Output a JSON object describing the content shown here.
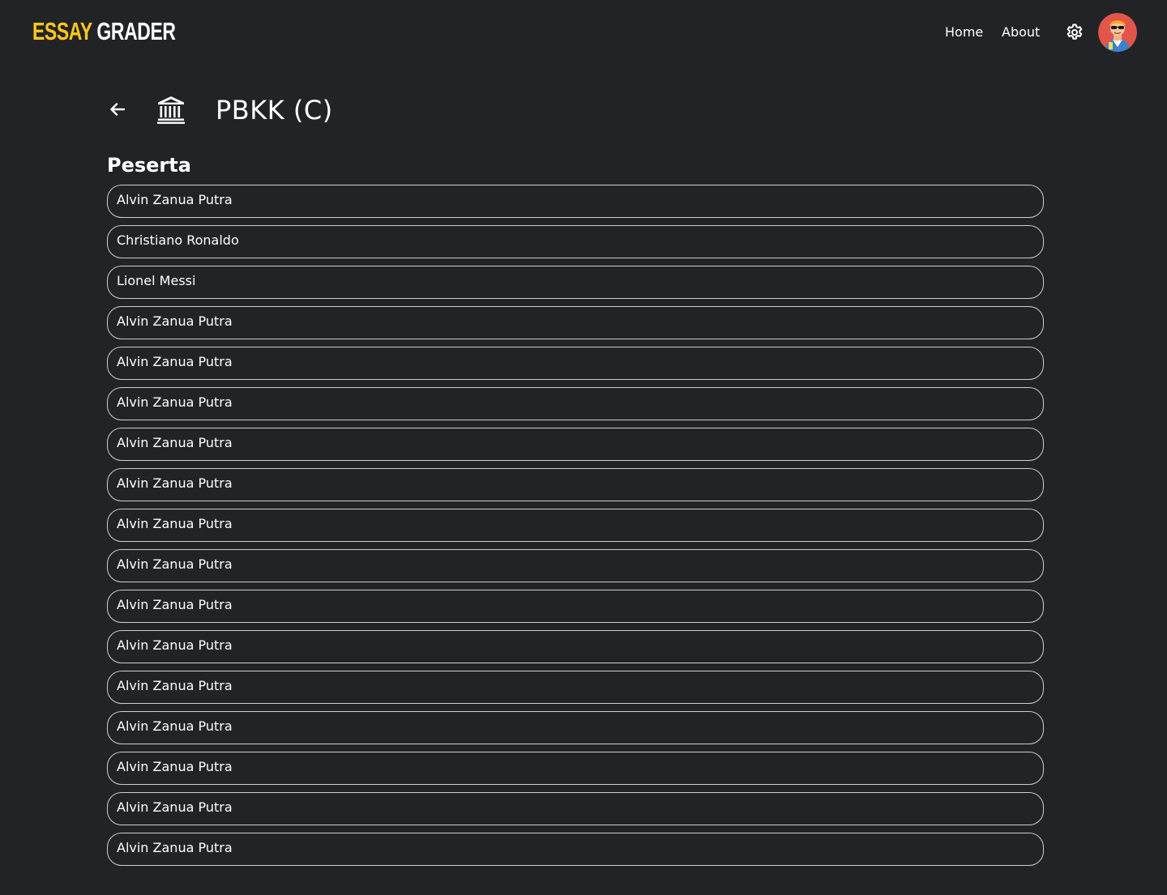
{
  "app": {
    "logo_part1": "ESSAY",
    "logo_part2": "GRADER",
    "colors": {
      "background": "#222326",
      "logo_accent": "#ffc81e",
      "item_border": "#cfcfd1"
    }
  },
  "nav": {
    "links": [
      {
        "label": "Home"
      },
      {
        "label": "About"
      }
    ],
    "settings_icon": "gear-icon",
    "avatar_icon": "user-avatar"
  },
  "page": {
    "back_icon": "arrow-left-icon",
    "class_icon": "bank-icon",
    "class_name": "PBKK (C)",
    "section_title": "Peserta"
  },
  "participants": [
    "Alvin Zanua Putra",
    "Christiano Ronaldo",
    "Lionel Messi",
    "Alvin Zanua Putra",
    "Alvin Zanua Putra",
    "Alvin Zanua Putra",
    "Alvin Zanua Putra",
    "Alvin Zanua Putra",
    "Alvin Zanua Putra",
    "Alvin Zanua Putra",
    "Alvin Zanua Putra",
    "Alvin Zanua Putra",
    "Alvin Zanua Putra",
    "Alvin Zanua Putra",
    "Alvin Zanua Putra",
    "Alvin Zanua Putra",
    "Alvin Zanua Putra"
  ]
}
